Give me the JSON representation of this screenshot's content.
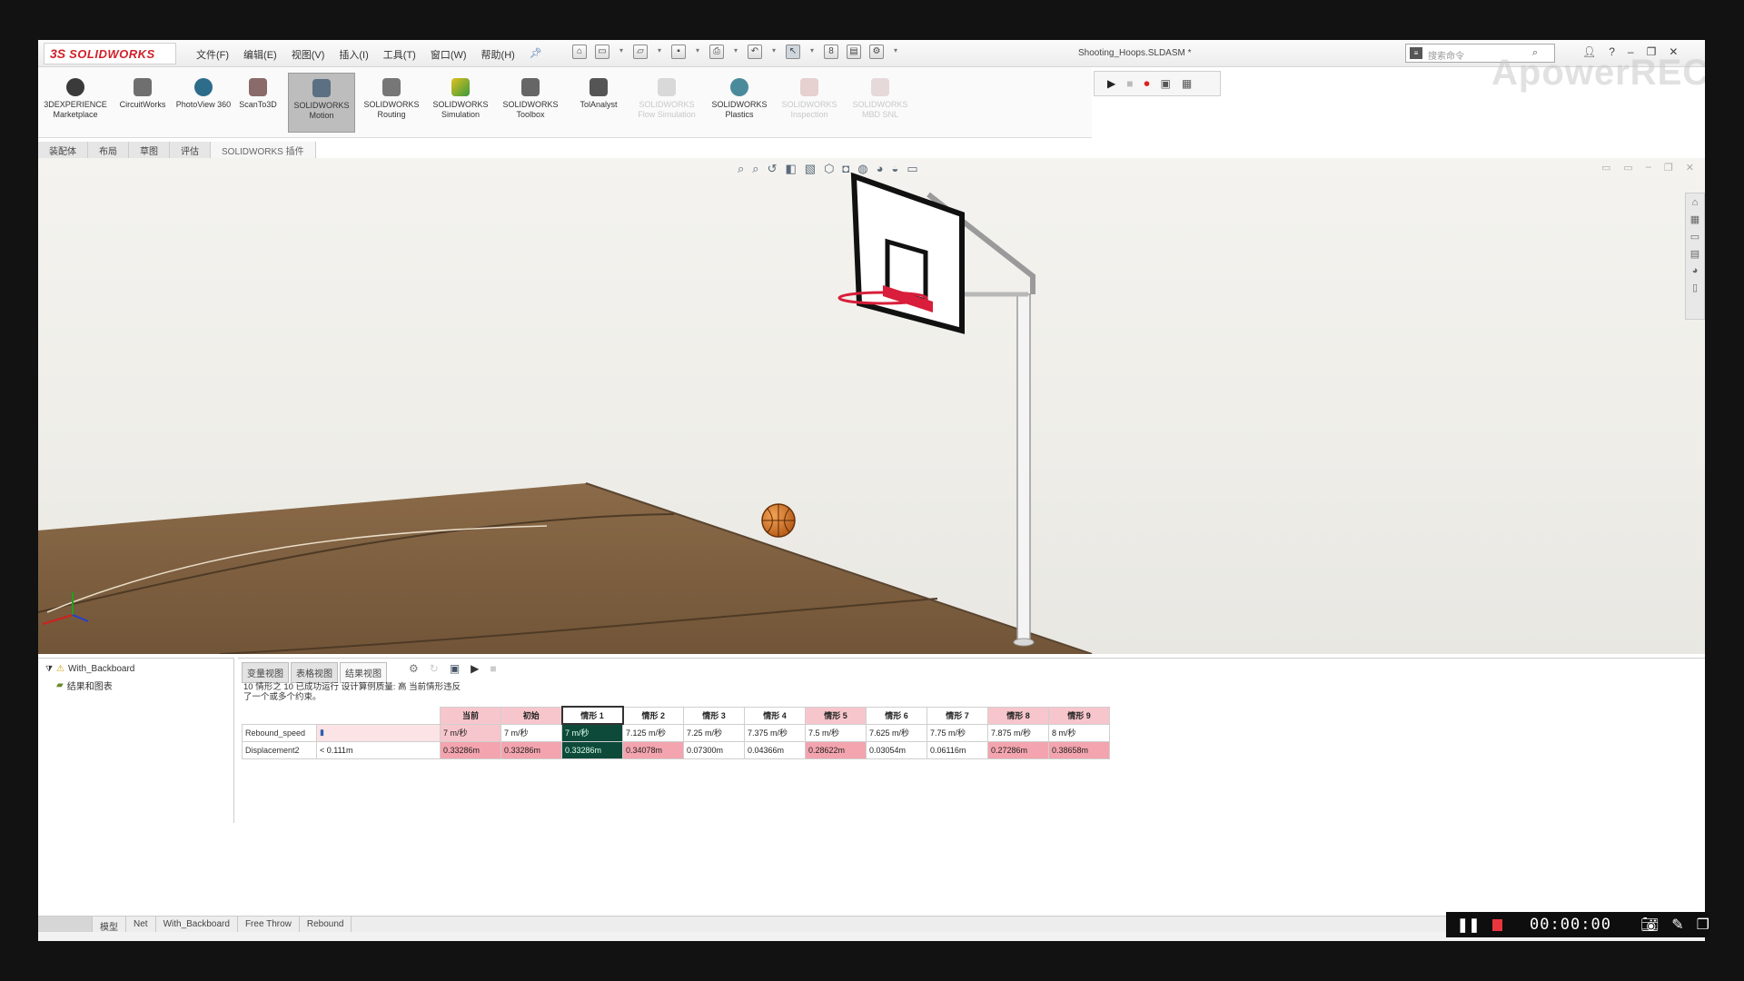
{
  "app": {
    "logo_ds": "3S",
    "logo_text": "SOLIDWORKS",
    "document_title": "Shooting_Hoops.SLDASM *",
    "search_placeholder": "搜索命令"
  },
  "menus": [
    "文件(F)",
    "编辑(E)",
    "视图(V)",
    "插入(I)",
    "工具(T)",
    "窗口(W)",
    "帮助(H)"
  ],
  "command_manager": [
    {
      "label": "3DEXPERIENCE Marketplace",
      "icon": "marketplace-icon",
      "state": "normal"
    },
    {
      "label": "CircuitWorks",
      "icon": "circuitworks-icon",
      "state": "normal"
    },
    {
      "label": "PhotoView 360",
      "icon": "photoview-icon",
      "state": "normal"
    },
    {
      "label": "ScanTo3D",
      "icon": "scanto3d-icon",
      "state": "normal"
    },
    {
      "label": "SOLIDWORKS Motion",
      "icon": "motion-icon",
      "state": "active"
    },
    {
      "label": "SOLIDWORKS Routing",
      "icon": "routing-icon",
      "state": "normal"
    },
    {
      "label": "SOLIDWORKS Simulation",
      "icon": "simulation-icon",
      "state": "normal"
    },
    {
      "label": "SOLIDWORKS Toolbox",
      "icon": "toolbox-icon",
      "state": "normal"
    },
    {
      "label": "TolAnalyst",
      "icon": "tolanalyst-icon",
      "state": "normal"
    },
    {
      "label": "SOLIDWORKS Flow Simulation",
      "icon": "flow-simulation-icon",
      "state": "disabled"
    },
    {
      "label": "SOLIDWORKS Plastics",
      "icon": "plastics-icon",
      "state": "normal"
    },
    {
      "label": "SOLIDWORKS Inspection",
      "icon": "inspection-icon",
      "state": "disabled"
    },
    {
      "label": "SOLIDWORKS MBD SNL",
      "icon": "mbd-icon",
      "state": "disabled"
    }
  ],
  "command_tabs": [
    "装配体",
    "布局",
    "草图",
    "评估",
    "SOLIDWORKS 插件"
  ],
  "watermark": "ApowerREC",
  "tree": {
    "root": "With_Backboard",
    "child": "结果和图表"
  },
  "motion_tabs": [
    "变量视图",
    "表格视图",
    "结果视图"
  ],
  "study_message": "10 情形之 10 已成功运行 设计算例质量: 高 当前情形违反了一个或多个约束。",
  "study_table": {
    "headers": [
      "当前",
      "初始",
      "情形 1",
      "情形 2",
      "情形 3",
      "情形 4",
      "情形 5",
      "情形 6",
      "情形 7",
      "情形 8",
      "情形 9"
    ],
    "rows": [
      {
        "label": "Rebound_speed",
        "current": "",
        "values": [
          "7 m/秒",
          "7 m/秒",
          "7 m/秒",
          "7.125 m/秒",
          "7.25 m/秒",
          "7.375 m/秒",
          "7.5 m/秒",
          "7.625 m/秒",
          "7.75 m/秒",
          "7.875 m/秒",
          "8 m/秒"
        ]
      },
      {
        "label": "Displacement2",
        "current": "< 0.111m",
        "values": [
          "0.33286m",
          "0.33286m",
          "0.33286m",
          "0.34078m",
          "0.07300m",
          "0.04366m",
          "0.28622m",
          "0.03054m",
          "0.06116m",
          "0.27286m",
          "0.38658m"
        ]
      }
    ]
  },
  "bottom_tabs": [
    "模型",
    "Net",
    "With_Backboard",
    "Free Throw",
    "Rebound"
  ],
  "recorder": {
    "time": "00:00:00"
  },
  "colors": {
    "accent_red": "#d0202a",
    "selected_cell": "#0e4a3a",
    "pink_cell": "#f7c6cc"
  }
}
